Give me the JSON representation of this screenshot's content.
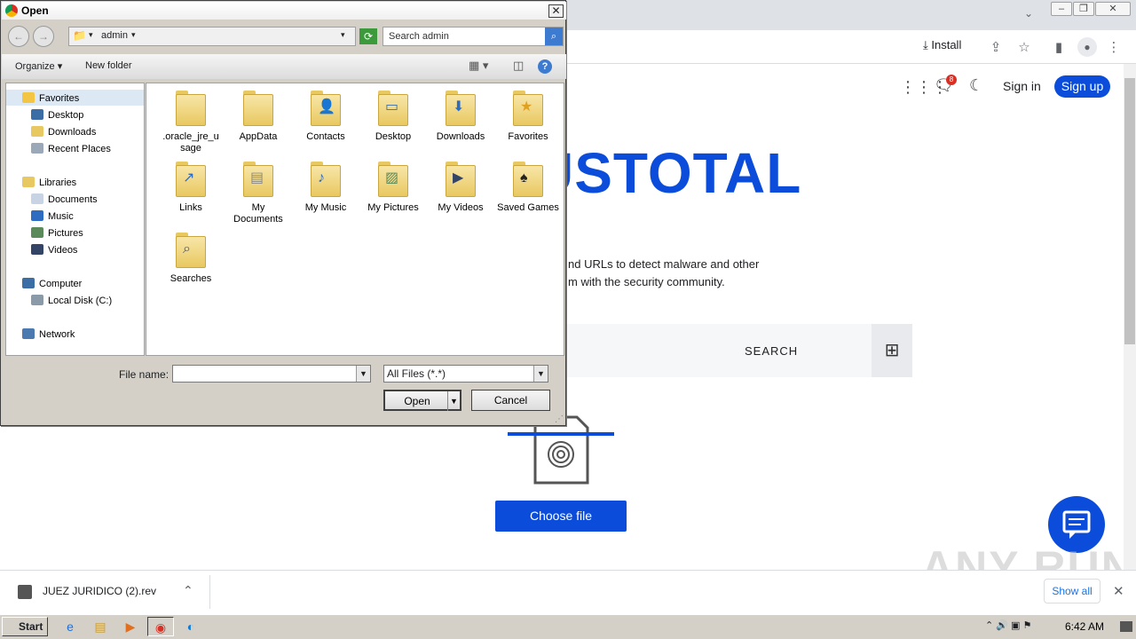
{
  "browser": {
    "install_label": "Install",
    "nav": {
      "signin": "Sign in",
      "signup": "Sign up",
      "notif_count": "8"
    }
  },
  "page": {
    "brand": "USTOTAL",
    "tagline1": "nd URLs to detect malware and other",
    "tagline2": "m with the security community.",
    "search_label": "SEARCH",
    "choose_file": "Choose file",
    "watermark": "ANY RUN"
  },
  "download": {
    "file": "JUEZ JURIDICO (2).rev",
    "show_all": "Show all"
  },
  "taskbar": {
    "start": "Start",
    "clock": "6:42 AM"
  },
  "dialog": {
    "title": "Open",
    "address": "admin",
    "search_placeholder": "Search admin",
    "organize": "Organize",
    "new_folder": "New folder",
    "nav": {
      "favorites": "Favorites",
      "desktop": "Desktop",
      "downloads": "Downloads",
      "recent": "Recent Places",
      "libraries": "Libraries",
      "documents": "Documents",
      "music": "Music",
      "pictures": "Pictures",
      "videos": "Videos",
      "computer": "Computer",
      "localdisk": "Local Disk (C:)",
      "network": "Network"
    },
    "folders": [
      {
        "name": ".oracle_jre_u sage",
        "icon": "folder-icon"
      },
      {
        "name": "AppData",
        "icon": "folder-icon"
      },
      {
        "name": "Contacts",
        "icon": "contacts-folder-icon"
      },
      {
        "name": "Desktop",
        "icon": "desktop-folder-icon"
      },
      {
        "name": "Downloads",
        "icon": "downloads-folder-icon"
      },
      {
        "name": "Favorites",
        "icon": "favorites-folder-icon"
      },
      {
        "name": "Links",
        "icon": "links-folder-icon"
      },
      {
        "name": "My Documents",
        "icon": "documents-folder-icon"
      },
      {
        "name": "My Music",
        "icon": "music-folder-icon"
      },
      {
        "name": "My Pictures",
        "icon": "pictures-folder-icon"
      },
      {
        "name": "My Videos",
        "icon": "videos-folder-icon"
      },
      {
        "name": "Saved Games",
        "icon": "games-folder-icon"
      },
      {
        "name": "Searches",
        "icon": "searches-folder-icon"
      }
    ],
    "filename_label": "File name:",
    "filename_value": "",
    "filetype": "All Files (*.*)",
    "open_label": "Open",
    "cancel_label": "Cancel"
  }
}
